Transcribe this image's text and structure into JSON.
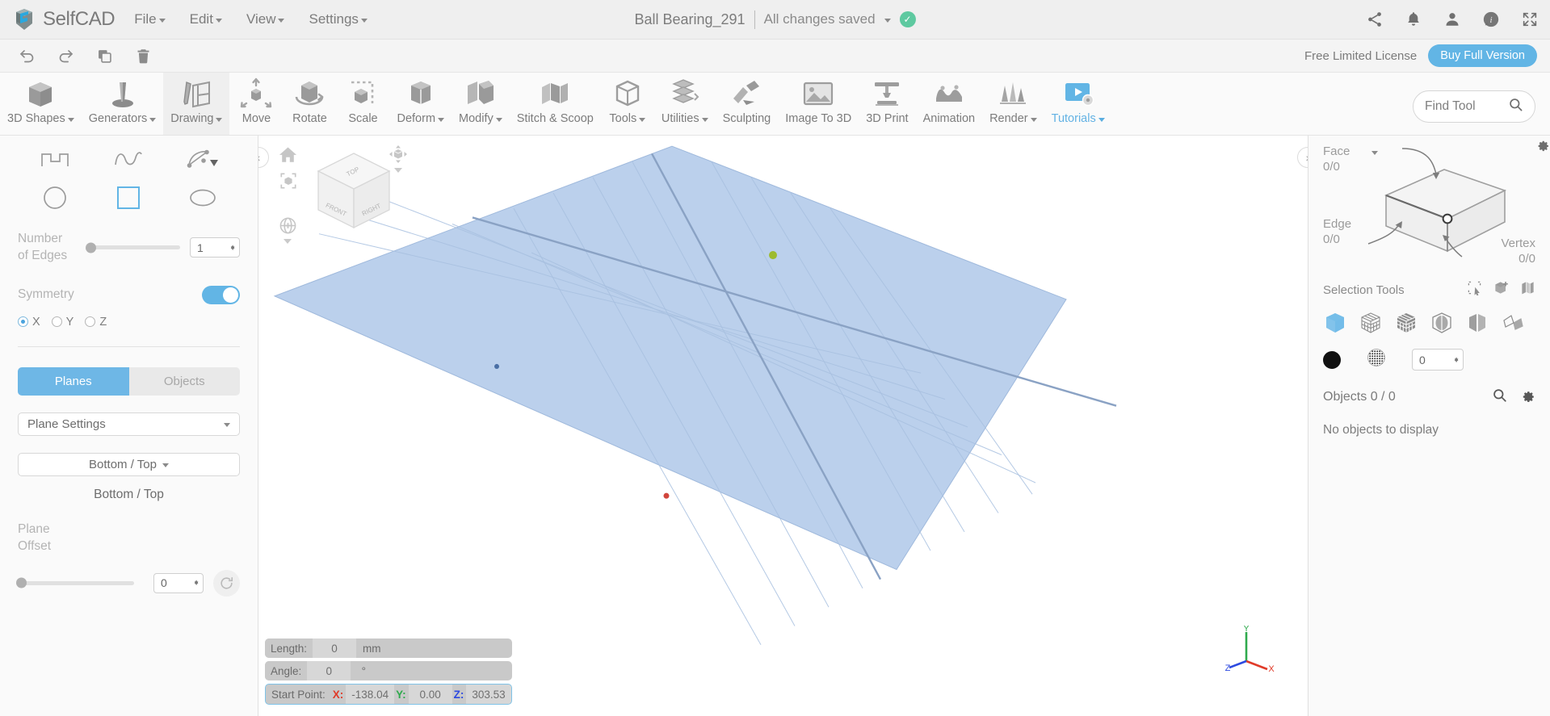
{
  "header": {
    "brand": "SelfCAD",
    "logo_icon": "selfcad-logo-icon",
    "menus": [
      {
        "label": "File",
        "caret": true
      },
      {
        "label": "Edit",
        "caret": true
      },
      {
        "label": "View",
        "caret": true
      },
      {
        "label": "Settings",
        "caret": true
      }
    ],
    "doc_title": "Ball Bearing_291",
    "save_status": "All changes saved",
    "save_check_glyph": "✓",
    "right_icons": [
      {
        "name": "share-icon"
      },
      {
        "name": "notifications-bell-icon"
      },
      {
        "name": "user-account-icon"
      },
      {
        "name": "info-icon"
      },
      {
        "name": "fullscreen-icon"
      }
    ]
  },
  "actionbar": {
    "buttons": [
      {
        "name": "undo-button",
        "icon": "undo-icon"
      },
      {
        "name": "redo-button",
        "icon": "redo-icon"
      },
      {
        "name": "copy-button",
        "icon": "copy-icon"
      },
      {
        "name": "delete-button",
        "icon": "trash-icon"
      }
    ],
    "license_text": "Free Limited License",
    "buy_label": "Buy Full Version"
  },
  "ribbon": {
    "tools": [
      {
        "label": "3D Shapes",
        "caret": true,
        "icon": "cube-icon",
        "active": false,
        "blue": false
      },
      {
        "label": "Generators",
        "caret": true,
        "icon": "generator-icon",
        "active": false,
        "blue": false
      },
      {
        "label": "Drawing",
        "caret": true,
        "icon": "pencil-drawing-icon",
        "active": true,
        "blue": false
      },
      {
        "label": "Move",
        "caret": false,
        "icon": "move-arrows-icon",
        "active": false,
        "blue": false
      },
      {
        "label": "Rotate",
        "caret": false,
        "icon": "rotate-icon",
        "active": false,
        "blue": false
      },
      {
        "label": "Scale",
        "caret": false,
        "icon": "scale-icon",
        "active": false,
        "blue": false
      },
      {
        "label": "Deform",
        "caret": true,
        "icon": "deform-icon",
        "active": false,
        "blue": false
      },
      {
        "label": "Modify",
        "caret": true,
        "icon": "modify-icon",
        "active": false,
        "blue": false
      },
      {
        "label": "Stitch & Scoop",
        "caret": false,
        "icon": "stitch-scoop-icon",
        "active": false,
        "blue": false
      },
      {
        "label": "Tools",
        "caret": true,
        "icon": "tools-icon",
        "active": false,
        "blue": false
      },
      {
        "label": "Utilities",
        "caret": true,
        "icon": "utilities-icon",
        "active": false,
        "blue": false
      },
      {
        "label": "Sculpting",
        "caret": false,
        "icon": "sculpting-icon",
        "active": false,
        "blue": false
      },
      {
        "label": "Image To 3D",
        "caret": false,
        "icon": "image-to-3d-icon",
        "active": false,
        "blue": false
      },
      {
        "label": "3D Print",
        "caret": false,
        "icon": "3d-print-icon",
        "active": false,
        "blue": false
      },
      {
        "label": "Animation",
        "caret": false,
        "icon": "animation-icon",
        "active": false,
        "blue": false
      },
      {
        "label": "Render",
        "caret": true,
        "icon": "render-icon",
        "active": false,
        "blue": false
      },
      {
        "label": "Tutorials",
        "caret": true,
        "icon": "tutorials-icon",
        "active": false,
        "blue": true
      }
    ],
    "find_tool_placeholder": "Find Tool",
    "find_tool_value": "",
    "find_tool_icon": "search-icon"
  },
  "left_panel": {
    "shapes": [
      {
        "name": "polyline-tool",
        "selected": false
      },
      {
        "name": "curve-tool",
        "selected": false
      },
      {
        "name": "bezier-tool",
        "selected": false,
        "caret": true
      },
      {
        "name": "circle-tool",
        "selected": false
      },
      {
        "name": "rectangle-tool",
        "selected": true
      },
      {
        "name": "ellipse-tool",
        "selected": false
      }
    ],
    "edges_label": "Number\nof Edges",
    "edges_label_l1": "Number",
    "edges_label_l2": "of Edges",
    "edges_value": "1",
    "symmetry_label": "Symmetry",
    "symmetry_on": true,
    "axes": [
      {
        "label": "X",
        "selected": true
      },
      {
        "label": "Y",
        "selected": false
      },
      {
        "label": "Z",
        "selected": false
      }
    ],
    "tabs": [
      {
        "label": "Planes",
        "active": true
      },
      {
        "label": "Objects",
        "active": false
      }
    ],
    "plane_settings_label": "Plane Settings",
    "plane_dropdown_value": "Bottom / Top",
    "plane_caption": "Bottom / Top",
    "offset_label_l1": "Plane",
    "offset_label_l2": "Offset",
    "offset_value": "0",
    "offset_reset_icon": "reset-rotate-icon"
  },
  "viewport": {
    "left_collapse_icon": "chevron-left-icon",
    "right_expand_icon": "chevron-right-icon",
    "home_icon": "home-icon",
    "fit-view_icon": "fit-to-view-icon",
    "orbit_icon": "orbit-icon",
    "snap_icon": "snap-icon",
    "viewcube_faces": {
      "top": "TOP",
      "front": "FRONT",
      "right": "RIGHT"
    },
    "axis_labels": {
      "x": "X",
      "y": "Y",
      "z": "Z"
    },
    "status": {
      "length_label": "Length:",
      "length_value": "0",
      "length_unit": "mm",
      "angle_label": "Angle:",
      "angle_value": "0",
      "angle_unit": "°",
      "start_point_label": "Start Point:",
      "x_label": "X:",
      "x_value": "-138.04",
      "y_label": "Y:",
      "y_value": "0.00",
      "z_label": "Z:",
      "z_value": "303.53"
    }
  },
  "right_panel": {
    "face_label": "Face",
    "face_count": "0/0",
    "edge_label": "Edge",
    "edge_count": "0/0",
    "vertex_label": "Vertex",
    "vertex_count": "0/0",
    "gear_icon": "settings-gear-icon",
    "selection_tools_title": "Selection Tools",
    "selection_top_icons": [
      {
        "name": "rectangle-select-icon"
      },
      {
        "name": "add-selection-icon"
      },
      {
        "name": "invert-selection-icon"
      }
    ],
    "selection_modes": [
      {
        "name": "select-object-icon",
        "active": true
      },
      {
        "name": "select-wireframe-icon",
        "active": false
      },
      {
        "name": "select-grid-icon",
        "active": false
      },
      {
        "name": "select-through-icon",
        "active": false
      },
      {
        "name": "select-half-icon",
        "active": false
      },
      {
        "name": "select-unfold-icon",
        "active": false
      }
    ],
    "fill_color": "#111111",
    "fill_swatch_icon": "solid-color-icon",
    "pattern_swatch_icon": "pattern-sphere-icon",
    "tolerance_value": "0",
    "objects_label": "Objects 0 / 0",
    "objects_search_icon": "search-icon",
    "objects_gear_icon": "settings-gear-icon",
    "empty_text": "No objects to display"
  },
  "colors": {
    "accent": "#62b5e5",
    "plane_fill": "#b9cfeb",
    "axis_x": "#e03b29",
    "axis_y": "#2faa4d",
    "axis_z": "#2d4ae0",
    "saved_green": "#5ec9a0"
  }
}
